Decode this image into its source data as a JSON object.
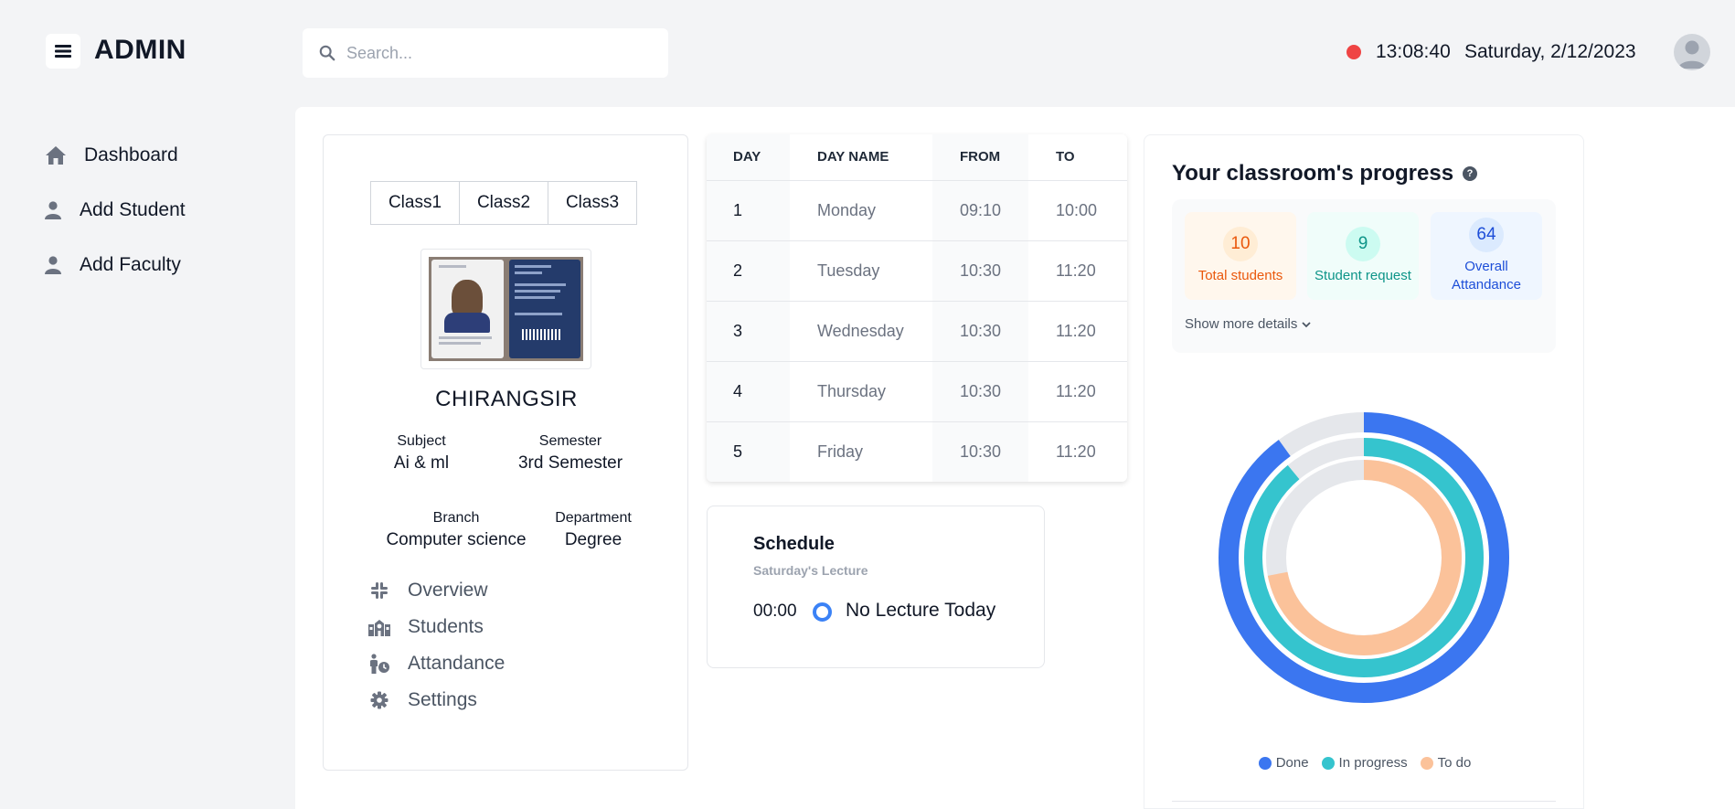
{
  "header": {
    "brand": "ADMIN",
    "search_placeholder": "Search...",
    "time": "13:08:40",
    "date": "Saturday, 2/12/2023"
  },
  "sidebar": {
    "items": [
      {
        "label": "Dashboard",
        "icon": "home-icon"
      },
      {
        "label": "Add Student",
        "icon": "user-icon"
      },
      {
        "label": "Add Faculty",
        "icon": "user-icon"
      }
    ]
  },
  "profile": {
    "classes": [
      "Class1",
      "Class2",
      "Class3"
    ],
    "name": "CHIRANGSIR",
    "subject_label": "Subject",
    "subject": "Ai & ml",
    "semester_label": "Semester",
    "semester": "3rd Semester",
    "branch_label": "Branch",
    "branch": "Computer science",
    "department_label": "Department",
    "department": "Degree",
    "menu": [
      {
        "label": "Overview",
        "icon": "slack-icon"
      },
      {
        "label": "Students",
        "icon": "school-icon"
      },
      {
        "label": "Attandance",
        "icon": "person-clock-icon"
      },
      {
        "label": "Settings",
        "icon": "gear-icon"
      }
    ]
  },
  "timetable": {
    "headers": [
      "DAY",
      "DAY NAME",
      "FROM",
      "TO"
    ],
    "rows": [
      [
        "1",
        "Monday",
        "09:10",
        "10:00"
      ],
      [
        "2",
        "Tuesday",
        "10:30",
        "11:20"
      ],
      [
        "3",
        "Wednesday",
        "10:30",
        "11:20"
      ],
      [
        "4",
        "Thursday",
        "10:30",
        "11:20"
      ],
      [
        "5",
        "Friday",
        "10:30",
        "11:20"
      ]
    ]
  },
  "schedule": {
    "title": "Schedule",
    "subtitle": "Saturday's Lecture",
    "time": "00:00",
    "text": "No Lecture Today"
  },
  "progress": {
    "title": "Your classroom's progress",
    "stats": [
      {
        "value": "10",
        "label": "Total students"
      },
      {
        "value": "9",
        "label": "Student request"
      },
      {
        "value": "64",
        "label": "Overall Attandance"
      }
    ],
    "show_more": "Show more details"
  },
  "chart_data": {
    "type": "pie",
    "subtype": "concentric-radial",
    "series": [
      {
        "name": "Done",
        "color": "#3b76f0",
        "fraction": 0.9
      },
      {
        "name": "In progress",
        "color": "#35c4ce",
        "fraction": 0.89
      },
      {
        "name": "To do",
        "color": "#fbc29a",
        "fraction": 0.72
      }
    ],
    "track_color": "#e5e7eb",
    "legend": [
      "Done",
      "In progress",
      "To do"
    ],
    "legend_position": "bottom"
  }
}
